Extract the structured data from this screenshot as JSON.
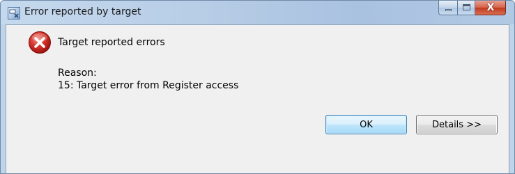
{
  "window": {
    "title": "Error reported by target",
    "controls": {
      "minimize_icon": "minimize-icon",
      "maximize_icon": "maximize-icon",
      "close_icon": "close-icon",
      "close_glyph": "X"
    }
  },
  "message": {
    "icon": "error-icon",
    "title": "Target reported errors",
    "reason_label": "Reason:",
    "reason_text": "15: Target error from Register access"
  },
  "buttons": {
    "ok_label": "OK",
    "details_label": "Details >>"
  },
  "colors": {
    "titlebar": "#b7cde6",
    "client_background": "#f0f0f0",
    "error_red": "#c6211b",
    "close_button": "#c1391c",
    "ok_button_border": "#3c7fb1"
  }
}
